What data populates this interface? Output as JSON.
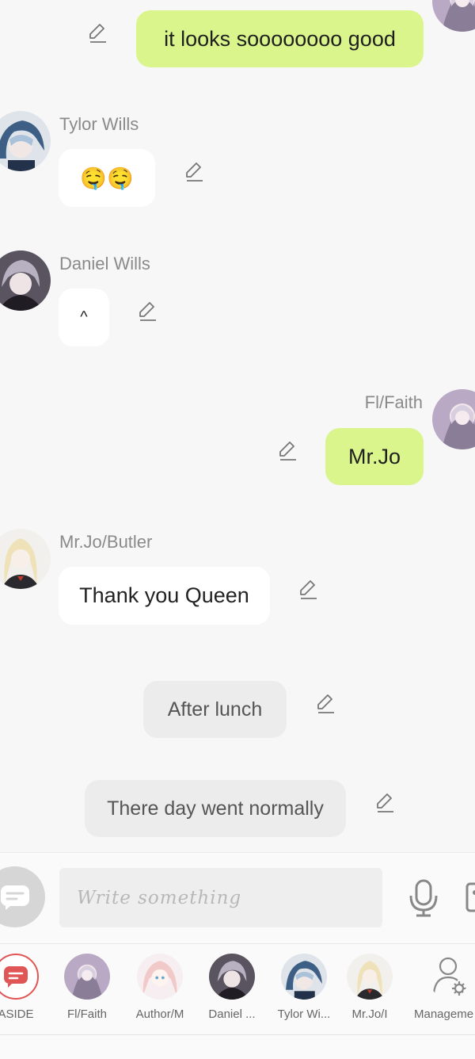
{
  "messages": [
    {
      "id": "m1",
      "side": "right",
      "text": "it looks soooooooo good"
    },
    {
      "id": "m2",
      "side": "left",
      "sender": "Tylor Wills",
      "text": "🤤🤤"
    },
    {
      "id": "m3",
      "side": "left",
      "sender": "Daniel Wills",
      "text": "^"
    },
    {
      "id": "m4",
      "side": "right",
      "sender": "Fl/Faith",
      "text": "Mr.Jo"
    },
    {
      "id": "m5",
      "side": "left",
      "sender": "Mr.Jo/Butler",
      "text": "Thank you Queen"
    },
    {
      "id": "m6",
      "side": "narration",
      "text": "After lunch"
    },
    {
      "id": "m7",
      "side": "narration",
      "text": "There day went normally"
    }
  ],
  "composer": {
    "placeholder": "Write something",
    "mode_icon": "chat-bubble-icon",
    "mic_icon": "microphone-icon",
    "media_icon": "image-icon"
  },
  "characters": [
    {
      "label": "ASIDE",
      "icon": "aside-bubble-icon"
    },
    {
      "label": "Fl/Faith",
      "icon": "avatar"
    },
    {
      "label": "Author/M",
      "icon": "avatar"
    },
    {
      "label": "Daniel ...",
      "icon": "avatar"
    },
    {
      "label": "Tylor Wi...",
      "icon": "avatar"
    },
    {
      "label": "Mr.Jo/I",
      "icon": "avatar"
    },
    {
      "label": "Manageme",
      "icon": "user-gear-icon"
    }
  ],
  "colors": {
    "outgoing_bubble": "#d9f58b",
    "incoming_bubble": "#ffffff",
    "narration_bubble": "#ececec",
    "aside_accent": "#e05555"
  }
}
